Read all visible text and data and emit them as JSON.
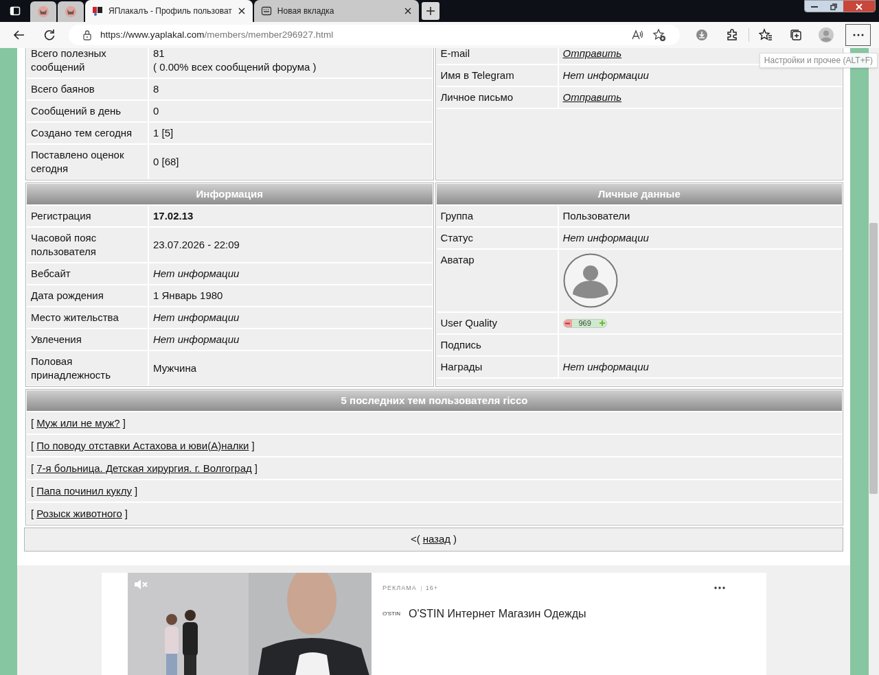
{
  "browser": {
    "tabs": [
      {
        "kind": "pinned",
        "selected": false
      },
      {
        "kind": "pinned",
        "selected": false
      },
      {
        "kind": "site",
        "label": "ЯПлакалъ - Профиль пользоват",
        "selected": true
      },
      {
        "kind": "newtab",
        "label": "Новая вкладка",
        "selected": false
      }
    ],
    "url": {
      "host": "https://www.yaplakal.com",
      "path": "/members/member296927.html"
    },
    "tooltip": "Настройки и прочее (ALT+F)"
  },
  "stats": {
    "rows": [
      {
        "label": "Всего полезных сообщений",
        "value_lines": [
          "81",
          "( 0.00% всех сообщений форума )"
        ]
      },
      {
        "label": "Всего баянов",
        "value_lines": [
          "8"
        ]
      },
      {
        "label": "Сообщений в день",
        "value_lines": [
          "0"
        ]
      },
      {
        "label": "Создано тем сегодня",
        "value_lines": [
          "1 [5]"
        ]
      },
      {
        "label": "Поставлено оценок сегодня",
        "value_lines": [
          "0 [68]"
        ]
      }
    ]
  },
  "contacts": {
    "rows": [
      {
        "label": "E-mail",
        "kind": "link",
        "value": "Отправить"
      },
      {
        "label": "Имя в Telegram",
        "kind": "italic",
        "value": "Нет информации"
      },
      {
        "label": "Личное письмо",
        "kind": "link",
        "value": "Отправить"
      }
    ]
  },
  "info": {
    "title": "Информация",
    "rows": [
      {
        "label": "Регистрация",
        "kind": "strong",
        "value": "17.02.13"
      },
      {
        "label": "Часовой пояс пользователя",
        "kind": "plain",
        "value": "23.07.2026 - 22:09"
      },
      {
        "label": "Вебсайт",
        "kind": "italic",
        "value": "Нет информации"
      },
      {
        "label": "Дата рождения",
        "kind": "plain",
        "value": "1 Январь 1980"
      },
      {
        "label": "Место жительства",
        "kind": "italic",
        "value": "Нет информации"
      },
      {
        "label": "Увлечения",
        "kind": "italic",
        "value": "Нет информации"
      },
      {
        "label": "Половая принадлежность",
        "kind": "plain",
        "value": "Мужчина"
      }
    ]
  },
  "personal": {
    "title": "Личные данные",
    "rows": [
      {
        "label": "Группа",
        "kind": "plain",
        "value": "Пользователи"
      },
      {
        "label": "Статус",
        "kind": "italic",
        "value": "Нет информации"
      },
      {
        "label": "Аватар",
        "kind": "avatar"
      },
      {
        "label": "User Quality",
        "kind": "quality",
        "value": "969"
      },
      {
        "label": "Подпись",
        "kind": "empty"
      },
      {
        "label": "Награды",
        "kind": "italic",
        "value": "Нет информации"
      }
    ]
  },
  "topics": {
    "title": "5 последних тем пользователя ricco",
    "items": [
      {
        "open": "[",
        "title": "Муж или не муж?",
        "close": "]"
      },
      {
        "open": "[",
        "title": "По поводу отставки Астахова и юви(А)налки",
        "close": "]"
      },
      {
        "open": "[",
        "title": "7-я больница. Детская хирургия. г. Волгоград",
        "close": "]"
      },
      {
        "open": "[",
        "title": "Папа починил куклу",
        "close": "]"
      },
      {
        "open": "[",
        "title": "Розыск животного",
        "close": "]"
      }
    ]
  },
  "back": {
    "prefix": "<(",
    "link": "назад",
    "suffix": ")"
  },
  "ad": {
    "kind": "picture",
    "label": "РЕКЛАМА",
    "age": "16+",
    "brand": "O'STIN",
    "title": "O'STIN Интернет Магазин Одежды"
  }
}
